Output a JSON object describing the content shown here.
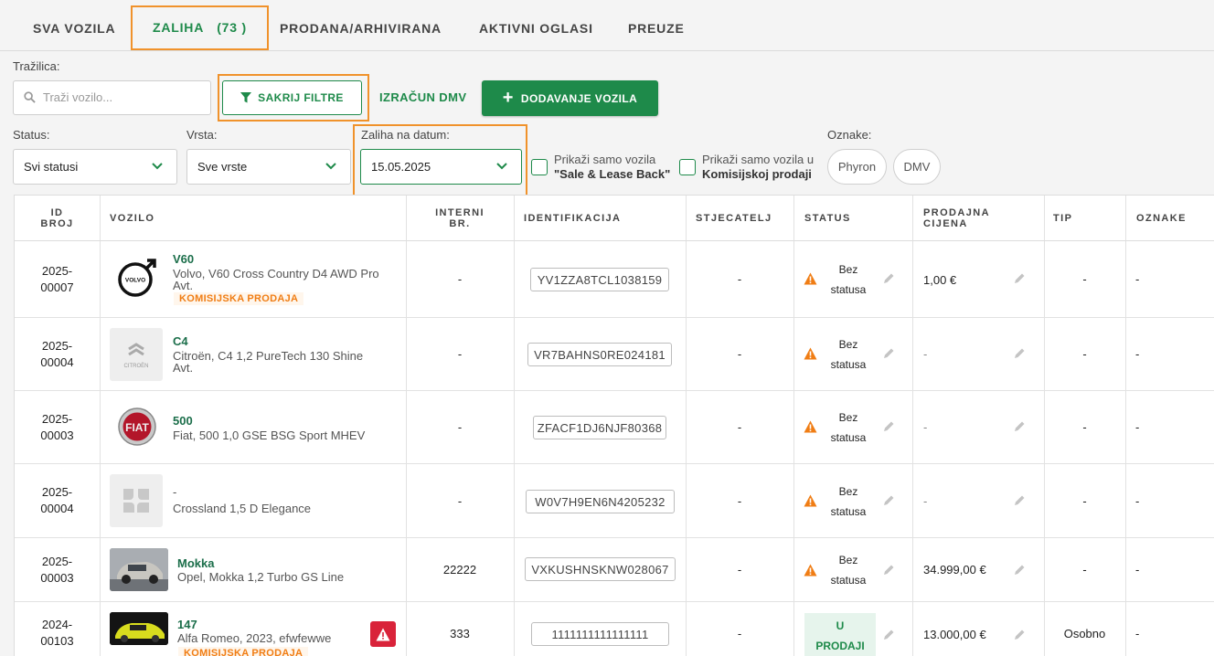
{
  "tabs": [
    {
      "label": "SVA VOZILA"
    },
    {
      "label": "ZALIHA",
      "count": "(73 )"
    },
    {
      "label": "PRODANA/ARHIVIRANA"
    },
    {
      "label": "AKTIVNI OGLASI"
    },
    {
      "label": "PREUZE"
    }
  ],
  "search": {
    "label": "Tražilica:",
    "placeholder": "Traži vozilo..."
  },
  "toolbar": {
    "hide_filters": "SAKRIJ FILTRE",
    "dmv_calc": "IZRAČUN DMV",
    "add_vehicle": "DODAVANJE VOZILA"
  },
  "filters": {
    "status_label": "Status:",
    "status_value": "Svi statusi",
    "type_label": "Vrsta:",
    "type_value": "Sve vrste",
    "date_label": "Zaliha na datum:",
    "date_value": "15.05.2025",
    "sale_lease_line1": "Prikaži samo vozila",
    "sale_lease_line2": "\"Sale & Lease Back\"",
    "commission_line1": "Prikaži samo vozila u",
    "commission_line2": "Komisijskoj prodaji",
    "tags_label": "Oznake:",
    "tag_phyron": "Phyron",
    "tag_dmv": "DMV"
  },
  "table": {
    "headers": {
      "id_1": "ID",
      "id_2": "BROJ",
      "vehicle": "VOZILO",
      "internal_1": "INTERNI",
      "internal_2": "BR.",
      "identification": "IDENTIFIKACIJA",
      "acquirer": "STJECATELJ",
      "status": "STATUS",
      "price_1": "PRODAJNA",
      "price_2": "CIJENA",
      "type": "TIP",
      "tags": "OZNAKE"
    },
    "rows": [
      {
        "id_1": "2025-",
        "id_2": "00007",
        "title": "V60",
        "sub_1": "Volvo, V60 Cross Country D4 AWD Pro",
        "sub_2": "Avt.",
        "badge": "KOMISIJSKA PRODAJA",
        "internal": "-",
        "vin": "YV1ZZA8TCL1038159",
        "acquirer": "-",
        "status_1": "Bez",
        "status_2": "statusa",
        "price": "1,00 €",
        "type": "-",
        "tags": "-"
      },
      {
        "id_1": "2025-",
        "id_2": "00004",
        "title": "C4",
        "sub_1": "Citroën, C4 1,2 PureTech 130 Shine",
        "sub_2": "Avt.",
        "logo_text": "CITROËN",
        "internal": "-",
        "vin": "VR7BAHNS0RE024181",
        "acquirer": "-",
        "status_1": "Bez",
        "status_2": "statusa",
        "price": "-",
        "type": "-",
        "tags": "-"
      },
      {
        "id_1": "2025-",
        "id_2": "00003",
        "title": "500",
        "sub_1": "Fiat, 500 1,0 GSE BSG Sport MHEV",
        "logo_text": "FIAT",
        "internal": "-",
        "vin": "ZFACF1DJ6NJF80368",
        "acquirer": "-",
        "status_1": "Bez",
        "status_2": "statusa",
        "price": "-",
        "type": "-",
        "tags": "-"
      },
      {
        "id_1": "2025-",
        "id_2": "00004",
        "title": "-",
        "sub_1": "Crossland 1,5 D Elegance",
        "internal": "-",
        "vin": "W0V7H9EN6N4205232",
        "acquirer": "-",
        "status_1": "Bez",
        "status_2": "statusa",
        "price": "-",
        "type": "-",
        "tags": "-"
      },
      {
        "id_1": "2025-",
        "id_2": "00003",
        "title": "Mokka",
        "sub_1": "Opel, Mokka 1,2 Turbo GS Line",
        "internal": "22222",
        "vin": "VXKUSHNSKNW028067",
        "acquirer": "-",
        "status_1": "Bez",
        "status_2": "statusa",
        "price": "34.999,00 €",
        "type": "-",
        "tags": "-"
      },
      {
        "id_1": "2024-",
        "id_2": "00103",
        "title": "147",
        "sub_1": "Alfa Romeo, 2023, efwfewwe",
        "badge": "KOMISIJSKA PRODAJA",
        "internal": "333",
        "vin": "1111111111111111",
        "acquirer": "-",
        "status_1": "U",
        "status_2": "PRODAJI",
        "price": "13.000,00 €",
        "type": "Osobno",
        "tags": "-"
      }
    ]
  },
  "colors": {
    "brand_green": "#1e8a4a",
    "highlight_orange": "#f0922b",
    "warning_orange": "#f07d14",
    "alert_red": "#d9233a"
  }
}
